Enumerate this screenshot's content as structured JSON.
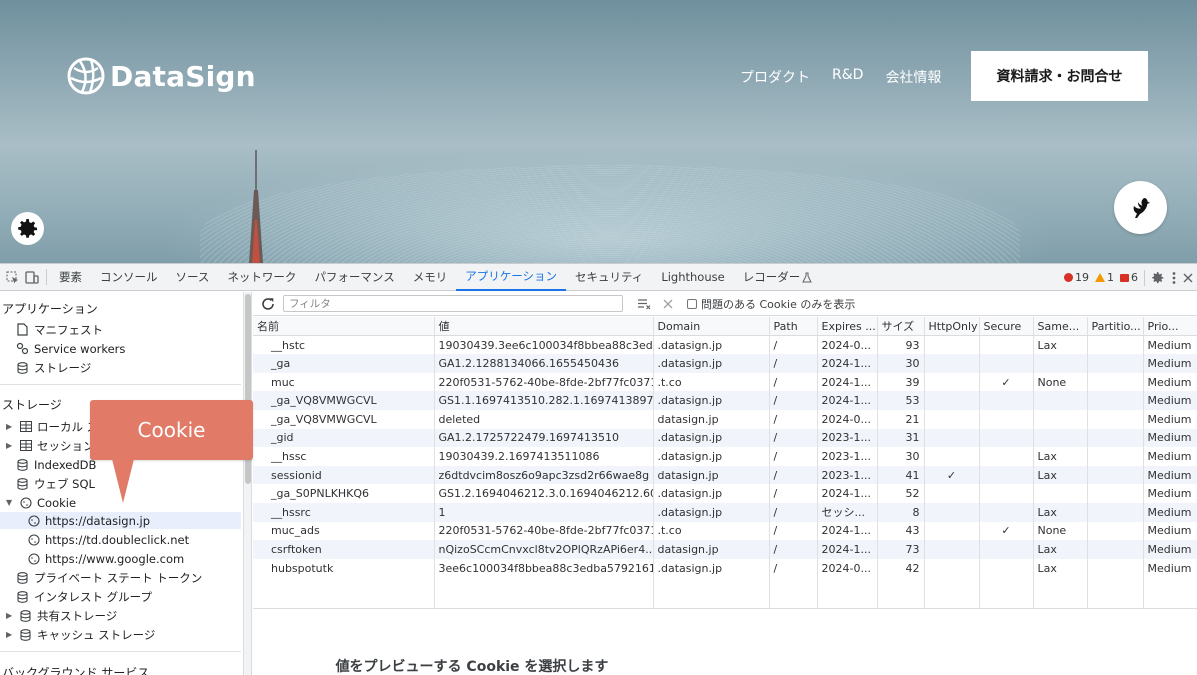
{
  "site": {
    "logo_text": "DataSign",
    "nav": [
      "プロダクト",
      "R&D",
      "会社情報"
    ],
    "cta": "資料請求・お問合せ"
  },
  "devtools": {
    "tabs": [
      "要素",
      "コンソール",
      "ソース",
      "ネットワーク",
      "パフォーマンス",
      "メモリ",
      "アプリケーション",
      "セキュリティ",
      "Lighthouse",
      "レコーダー"
    ],
    "active_tab": "アプリケーション",
    "counts": {
      "errors": "19",
      "warnings": "1",
      "issues": "6"
    },
    "sidebar": {
      "app_header": "アプリケーション",
      "app_items": [
        "マニフェスト",
        "Service workers",
        "ストレージ"
      ],
      "storage_header": "ストレージ",
      "storage_items": [
        "ローカル ス",
        "セッション",
        "IndexedDB",
        "ウェブ SQL",
        "Cookie"
      ],
      "cookie_sites": [
        "https://datasign.jp",
        "https://td.doubleclick.net",
        "https://www.google.com"
      ],
      "more_items": [
        "プライベート ステート トークン",
        "インタレスト グループ",
        "共有ストレージ",
        "キャッシュ ストレージ"
      ],
      "bg_header": "バックグラウンド サービス"
    },
    "callout": "Cookie",
    "toolbar": {
      "filter_placeholder": "フィルタ",
      "issue_filter_label": "問題のある Cookie のみを表示"
    },
    "table": {
      "columns": [
        "名前",
        "値",
        "Domain",
        "Path",
        "Expires ...",
        "サイズ",
        "HttpOnly",
        "Secure",
        "Same...",
        "Partitio...",
        "Prio..."
      ],
      "rows": [
        [
          "__hstc",
          "19030439.3ee6c100034f8bbea88c3edb...",
          ".datasign.jp",
          "/",
          "2024-0...",
          "93",
          "",
          "",
          "Lax",
          "",
          "Medium"
        ],
        [
          "_ga",
          "GA1.2.1288134066.1655450436",
          ".datasign.jp",
          "/",
          "2024-1...",
          "30",
          "",
          "",
          "",
          "",
          "Medium"
        ],
        [
          "muc",
          "220f0531-5762-40be-8fde-2bf77fc0371c",
          ".t.co",
          "/",
          "2024-1...",
          "39",
          "",
          "✓",
          "None",
          "",
          "Medium"
        ],
        [
          "_ga_VQ8VMWGCVL",
          "GS1.1.1697413510.282.1.1697413897....",
          ".datasign.jp",
          "/",
          "2024-1...",
          "53",
          "",
          "",
          "",
          "",
          "Medium"
        ],
        [
          "_ga_VQ8VMWGCVL",
          "deleted",
          "datasign.jp",
          "/",
          "2024-0...",
          "21",
          "",
          "",
          "",
          "",
          "Medium"
        ],
        [
          "_gid",
          "GA1.2.1725722479.1697413510",
          ".datasign.jp",
          "/",
          "2023-1...",
          "31",
          "",
          "",
          "",
          "",
          "Medium"
        ],
        [
          "__hssc",
          "19030439.2.1697413511086",
          ".datasign.jp",
          "/",
          "2023-1...",
          "30",
          "",
          "",
          "Lax",
          "",
          "Medium"
        ],
        [
          "sessionid",
          "z6dtdvcim8osz6o9apc3zsd2r66wae8g",
          "datasign.jp",
          "/",
          "2023-1...",
          "41",
          "✓",
          "",
          "Lax",
          "",
          "Medium"
        ],
        [
          "_ga_S0PNLKHKQ6",
          "GS1.2.1694046212.3.0.1694046212.60....",
          ".datasign.jp",
          "/",
          "2024-1...",
          "52",
          "",
          "",
          "",
          "",
          "Medium"
        ],
        [
          "__hssrc",
          "1",
          ".datasign.jp",
          "/",
          "セッシ...",
          "8",
          "",
          "",
          "Lax",
          "",
          "Medium"
        ],
        [
          "muc_ads",
          "220f0531-5762-40be-8fde-2bf77fc0371c",
          ".t.co",
          "/",
          "2024-1...",
          "43",
          "",
          "✓",
          "None",
          "",
          "Medium"
        ],
        [
          "csrftoken",
          "nQizoSCcmCnvxcl8tv2OPlQRzAPi6er4...",
          "datasign.jp",
          "/",
          "2024-1...",
          "73",
          "",
          "",
          "Lax",
          "",
          "Medium"
        ],
        [
          "hubspotutk",
          "3ee6c100034f8bbea88c3edba5792161",
          ".datasign.jp",
          "/",
          "2024-0...",
          "42",
          "",
          "",
          "Lax",
          "",
          "Medium"
        ]
      ]
    },
    "preview_text": "値をプレビューする Cookie を選択します"
  }
}
